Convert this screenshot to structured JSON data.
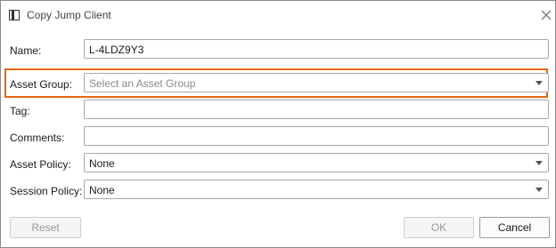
{
  "window": {
    "title": "Copy Jump Client",
    "close_icon": "close-icon",
    "app_icon": "window-icon"
  },
  "form": {
    "name": {
      "label": "Name:",
      "value": "L-4LDZ9Y3"
    },
    "asset_group": {
      "label": "Asset Group:",
      "placeholder": "Select an Asset Group",
      "highlighted": true,
      "highlight_color": "#e8650e"
    },
    "tag": {
      "label": "Tag:",
      "value": ""
    },
    "comments": {
      "label": "Comments:",
      "value": ""
    },
    "asset_policy": {
      "label": "Asset Policy:",
      "selected": "None"
    },
    "session_policy": {
      "label": "Session Policy:",
      "selected": "None"
    }
  },
  "buttons": {
    "reset": {
      "label": "Reset",
      "enabled": false
    },
    "ok": {
      "label": "OK",
      "enabled": false
    },
    "cancel": {
      "label": "Cancel",
      "enabled": true
    }
  }
}
